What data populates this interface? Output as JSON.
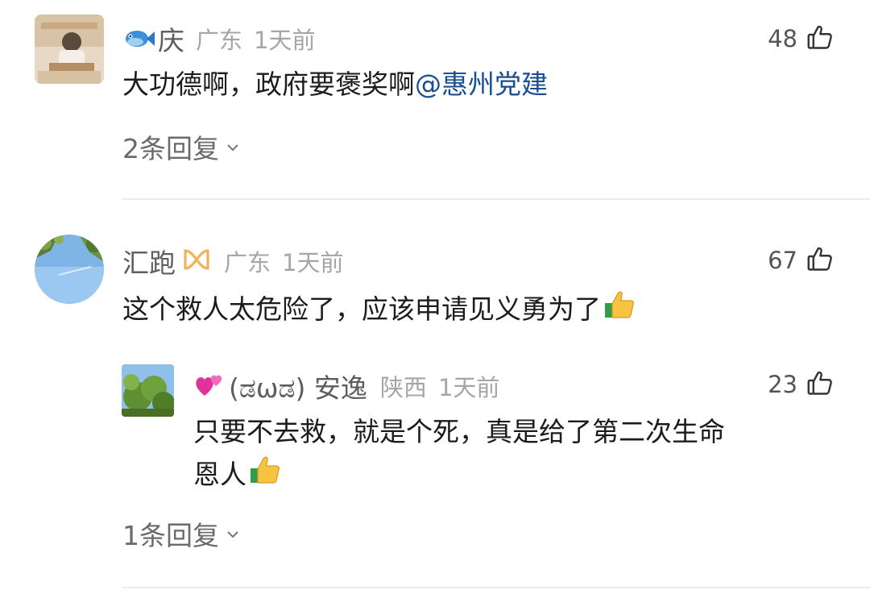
{
  "comments": [
    {
      "username": "庆",
      "name_emoji": "fish-emoji",
      "location": "广东",
      "time": "1天前",
      "likes": "48",
      "text": "大功德啊，政府要褒奖啊",
      "mention": "@惠州党建",
      "reply_count_label": "2条回复"
    },
    {
      "username": "汇跑",
      "badge": "infinity-badge-icon",
      "location": "广东",
      "time": "1天前",
      "likes": "67",
      "text": "这个救人太危险了，应该申请见义勇为了",
      "text_emoji": "thumbs-up-emoji",
      "reply": {
        "username": "(ಡωಡ) 安逸",
        "name_emoji": "two-hearts-emoji",
        "location": "陕西",
        "time": "1天前",
        "likes": "23",
        "text_line1": "只要不去救，就是个死，真是给了第二次生命",
        "text_line2": "恩人",
        "text_emoji": "thumbs-up-emoji"
      },
      "reply_count_label": "1条回复"
    }
  ],
  "colors": {
    "mention": "#1b4f93",
    "meta": "#a6a6a6",
    "divider": "#ececec",
    "badge": "#f0b25b"
  }
}
